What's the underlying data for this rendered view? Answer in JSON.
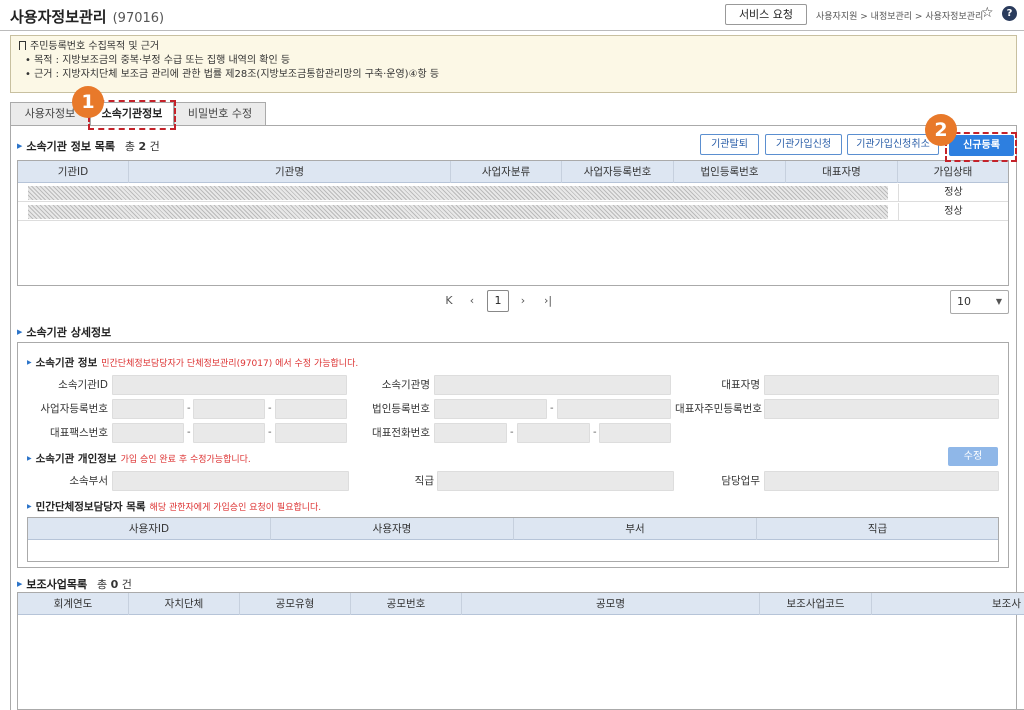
{
  "header": {
    "title": "사용자정보관리",
    "code": "(97016)",
    "service_button": "서비스 요청",
    "breadcrumb": "사용자지원 > 내정보관리 > 사용자정보관리",
    "star_icon": "☆",
    "help_icon": "?"
  },
  "notice": {
    "title": "주민등록번호 수집목적 및 근거",
    "purpose": "• 목적 : 지방보조금의 중복·부정 수급 또는 집행 내역의 확인 등",
    "basis": "• 근거 : 지방자치단체 보조금 관리에 관한 법률 제28조(지방보조금통합관리망의 구축·운영)④항 등"
  },
  "tabs": [
    {
      "label": "사용자정보",
      "active": false
    },
    {
      "label": "소속기관정보",
      "active": true
    },
    {
      "label": "비밀번호 수정",
      "active": false
    }
  ],
  "annotations": {
    "badge1": "1",
    "badge2": "2"
  },
  "org_list": {
    "title": "소속기관 정보 목록",
    "count_prefix": "총",
    "count": "2",
    "count_suffix": "건",
    "buttons": {
      "leave": "기관탈퇴",
      "join": "기관가입신청",
      "cancel": "기관가입신청취소",
      "new": "신규등록"
    },
    "columns": [
      "기관ID",
      "기관명",
      "사업자분류",
      "사업자등록번호",
      "법인등록번호",
      "대표자명",
      "가입상태"
    ],
    "rows": [
      {
        "status": "정상"
      },
      {
        "status": "정상"
      }
    ]
  },
  "pager": {
    "first": "K",
    "prev": "‹",
    "current": "1",
    "next": "›",
    "last": "›|",
    "page_size": "10",
    "caret": "▼"
  },
  "detail": {
    "title": "소속기관 상세정보",
    "org_info": {
      "title": "소속기관 정보",
      "note": "민간단체정보담당자가 단체정보관리(97017) 에서 수정 가능합니다.",
      "labels": {
        "org_id": "소속기관ID",
        "org_name": "소속기관명",
        "ceo_name": "대표자명",
        "biz_no": "사업자등록번호",
        "corp_no": "법인등록번호",
        "ceo_rrn": "대표자주민등록번호",
        "fax": "대표팩스번호",
        "tel": "대표전화번호"
      },
      "dash": "-"
    },
    "personal": {
      "title": "소속기관 개인정보",
      "note": "가입 승인 완료 후 수정가능합니다.",
      "edit_button": "수정",
      "labels": {
        "dept": "소속부서",
        "position": "직급",
        "duty": "담당업무"
      }
    },
    "managers": {
      "title": "민간단체정보담당자 목록",
      "note": "해당 관한자에게 가입승인 요청이 필요합니다.",
      "columns": [
        "사용자ID",
        "사용자명",
        "부서",
        "직급"
      ]
    }
  },
  "subsidy": {
    "title": "보조사업목록",
    "count_prefix": "총",
    "count": "0",
    "count_suffix": "건",
    "columns": [
      "회계연도",
      "자치단체",
      "공모유형",
      "공모번호",
      "공모명",
      "보조사업코드",
      "보조사"
    ]
  },
  "colors": {
    "accent": "#2d7fe0",
    "badge": "#e8792a",
    "highlight": "#c4222a",
    "note": "#dd3333"
  }
}
